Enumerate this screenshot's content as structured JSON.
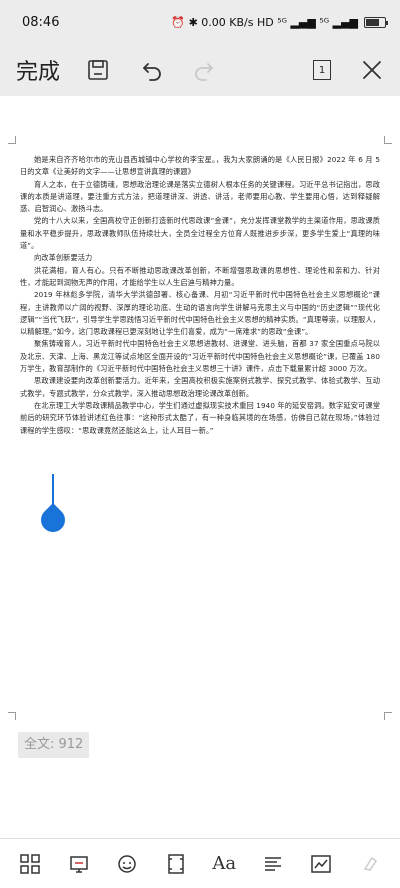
{
  "status_bar": {
    "time": "08:46",
    "indicators": "⏰ ✱ 0.00 KB/s HD ⁵ᴳ ▂▄▆ ⁵ᴳ ▂▄▆",
    "battery_level": 0.7
  },
  "toolbar": {
    "done_label": "完成",
    "page_count": "1",
    "icons": [
      "save-icon",
      "undo-icon",
      "redo-icon",
      "pages-icon",
      "close-icon"
    ]
  },
  "document": {
    "paragraphs": [
      "她是来自齐齐哈尔市的克山县西城镇中心学校的李宝星。，我为大家朗诵的是《人民日报》2022 年 6 月 5 日的文章《让美好的文字——让思想宣讲真理的课题》",
      "育人之本，在于立德铸魂，思想政治理论课是落实立德树人根本任务的关键课程。习近平总书记指出，思政课的本质是讲道理，要注重方式方法，把道理讲深、讲透、讲活，老师要用心教、学生要用心悟，达到释疑解惑、启智润心、激扬斗志。",
      "党的十八大以来，全国高校守正创新打造新时代思政课“金课”，充分发挥课堂教学的主渠道作用，思政课质量和水平稳步提升，思政课教师队伍持续壮大，全员全过程全方位育人既推进步步深，更多学生爱上“真理的味道”。",
      "向改革创新要活力",
      "洪花满相，育人有心。只有不断推动思政课改革创新，不断增强思政课的思想性、理论性和亲和力、针对性，才能起到润物无声的作用，才能给学生以人生启迪与精神力量。",
      "2019 年林彪多学院，清华大学洪德部署、核心备课、月初“习近平新时代中国特色社会主义思想概论”课程，主讲教师以广阔的视野、深厚的理论功底、生动的语言向学生讲解马克思主义与中国的“历史逻辑”“现代化逻辑”“当代飞跃”，引导学生学思践悟习近平新时代中国特色社会主义思想的精神实质。“真理尊崇，以理服人，以精解理。”如今，这门思政课程已更深刻地让学生们喜爱，成为“一席难求”的思政“金课”。",
      "聚焦铸魂育人，习近平新时代中国特色社会主义思想进教材、进课堂、进头脑，首都 37 家全国重点马院以及北京、天津、上海、黑龙江等试点地区全面开设的“习近平新时代中国特色社会主义思想概论”课，已覆盖 180 万学生，教育部制作的《习近平新时代中国特色社会主义思想三十讲》课件，点击下载量累计超 3000 万次。",
      "思政课建设要向改革创新要活力。近年来，全国高校积极实施案例式教学、探究式教学、体验式教学、互动式教学，专题式教学，分众式教学，深入推动思想政治理论课改革创新。",
      "在北京理工大学思政课精品教学中心，学生们通过虚拟现实技术重回 1940 年的延安窑洞。数字延安可课堂前后的研究环节体验讲述红色往事：“这种形式太酷了，有一种身临其境的在场感，仿佛自己就在现场，”体验过课程的学生感叹：“思政课竟然还能这么上，让人耳目一新。”"
    ]
  },
  "word_count": "全文: 912",
  "bottom_bar": {
    "icons": [
      "grid-icon",
      "presentation-icon",
      "voice-icon",
      "page-layout-icon",
      "font-icon",
      "paragraph-icon",
      "chart-icon",
      "clear-icon"
    ],
    "font_label": "Aa"
  }
}
